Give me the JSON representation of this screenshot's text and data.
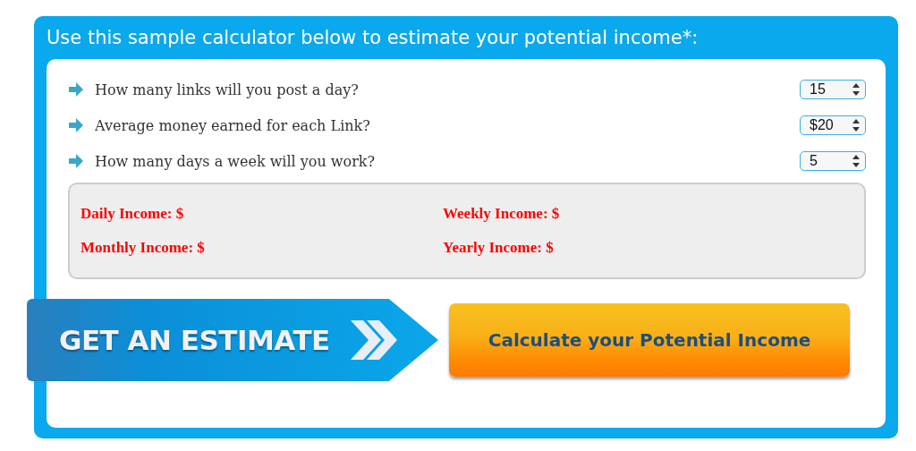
{
  "title": "Use this sample calculator below to estimate your potential income*:",
  "questions": [
    {
      "label": "How many links will you post a day?",
      "value": "15"
    },
    {
      "label": "Average money earned for each Link?",
      "value": "$20"
    },
    {
      "label": "How many days a week will you work?",
      "value": "5"
    }
  ],
  "results": [
    "Daily Income: $",
    "Weekly Income: $",
    "Monthly Income: $",
    "Yearly Income: $"
  ],
  "banner": "GET AN ESTIMATE",
  "calculate_button": "Calculate your Potential Income"
}
